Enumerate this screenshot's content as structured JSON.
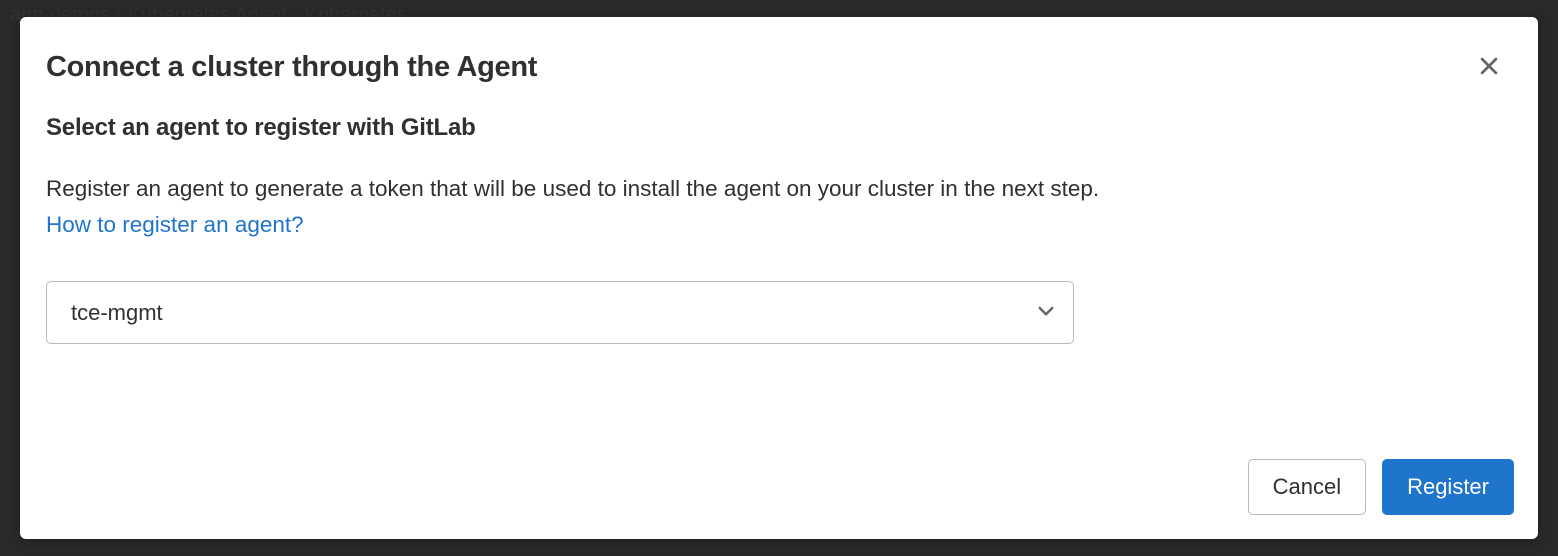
{
  "backdrop": {
    "breadcrumb": "ann-demos  ›  Kubernetes Agent  ›  Kubernetes"
  },
  "modal": {
    "title": "Connect a cluster through the Agent",
    "subtitle": "Select an agent to register with GitLab",
    "description": "Register an agent to generate a token that will be used to install the agent on your cluster in the next step.",
    "help_link": "How to register an agent?",
    "dropdown": {
      "selected": "tce-mgmt"
    },
    "buttons": {
      "cancel": "Cancel",
      "register": "Register"
    }
  }
}
